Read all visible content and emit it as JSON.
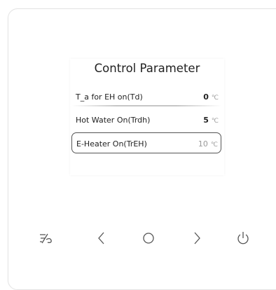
{
  "panel": {
    "title": "Control Parameter",
    "params": [
      {
        "label": "T_a for EH on(Td)",
        "value": "0",
        "unit": "℃",
        "selected": false
      },
      {
        "label": "Hot Water On(Trdh)",
        "value": "5",
        "unit": "℃",
        "selected": false
      },
      {
        "label": "E-Heater On(TrEH)",
        "value": "10",
        "unit": "℃",
        "selected": true
      }
    ]
  },
  "buttons": [
    {
      "icon": "lock-slash-icon"
    },
    {
      "icon": "chevron-left-icon"
    },
    {
      "icon": "circle-ok-icon"
    },
    {
      "icon": "chevron-right-icon"
    },
    {
      "icon": "power-icon"
    }
  ],
  "colors": {
    "text": "#222222",
    "unit": "#999999",
    "icon": "#555555",
    "selection_border": "#555555"
  }
}
